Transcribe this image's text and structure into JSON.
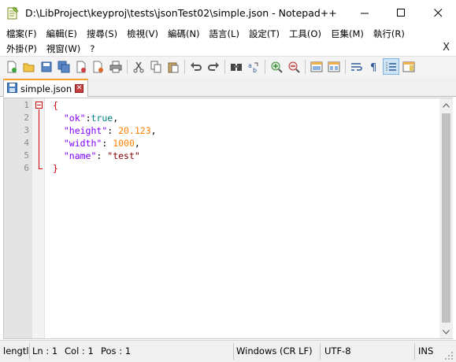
{
  "window": {
    "title": "D:\\LibProject\\keyproj\\tests\\jsonTest02\\simple.json - Notepad++"
  },
  "menu": {
    "row1": [
      "檔案(F)",
      "編輯(E)",
      "搜尋(S)",
      "檢視(V)",
      "編碼(N)",
      "語言(L)",
      "設定(T)",
      "工具(O)",
      "巨集(M)",
      "執行(R)"
    ],
    "row2": [
      "外掛(P)",
      "視窗(W)",
      "?"
    ],
    "close_glyph": "X"
  },
  "tab": {
    "label": "simple.json"
  },
  "editor": {
    "line_numbers": [
      "1",
      "2",
      "3",
      "4",
      "5",
      "6"
    ],
    "code": {
      "l1_brace": "{",
      "l2_key": "\"ok\"",
      "l2_colon": ":",
      "l2_value": "true",
      "l2_comma": ",",
      "l3_key": "\"height\"",
      "l3_colon": ": ",
      "l3_value": "20.123",
      "l3_comma": ",",
      "l4_key": "\"width\"",
      "l4_colon": ": ",
      "l4_value": "1000",
      "l4_comma": ",",
      "l5_key": "\"name\"",
      "l5_colon": ": ",
      "l5_value": "\"test\"",
      "l6_brace": "}"
    }
  },
  "status": {
    "length": "lengtl",
    "ln": "Ln : 1",
    "col": "Col : 1",
    "pos": "Pos : 1",
    "eol": "Windows (CR LF)",
    "encoding": "UTF-8",
    "mode": "INS"
  },
  "colors": {
    "tab_accent": "#f59f2a",
    "current_line": "#e8e8ff",
    "brace": "#d10000",
    "key": "#8000ff",
    "number": "#ff8000",
    "boolean": "#008080",
    "string": "#800000"
  }
}
